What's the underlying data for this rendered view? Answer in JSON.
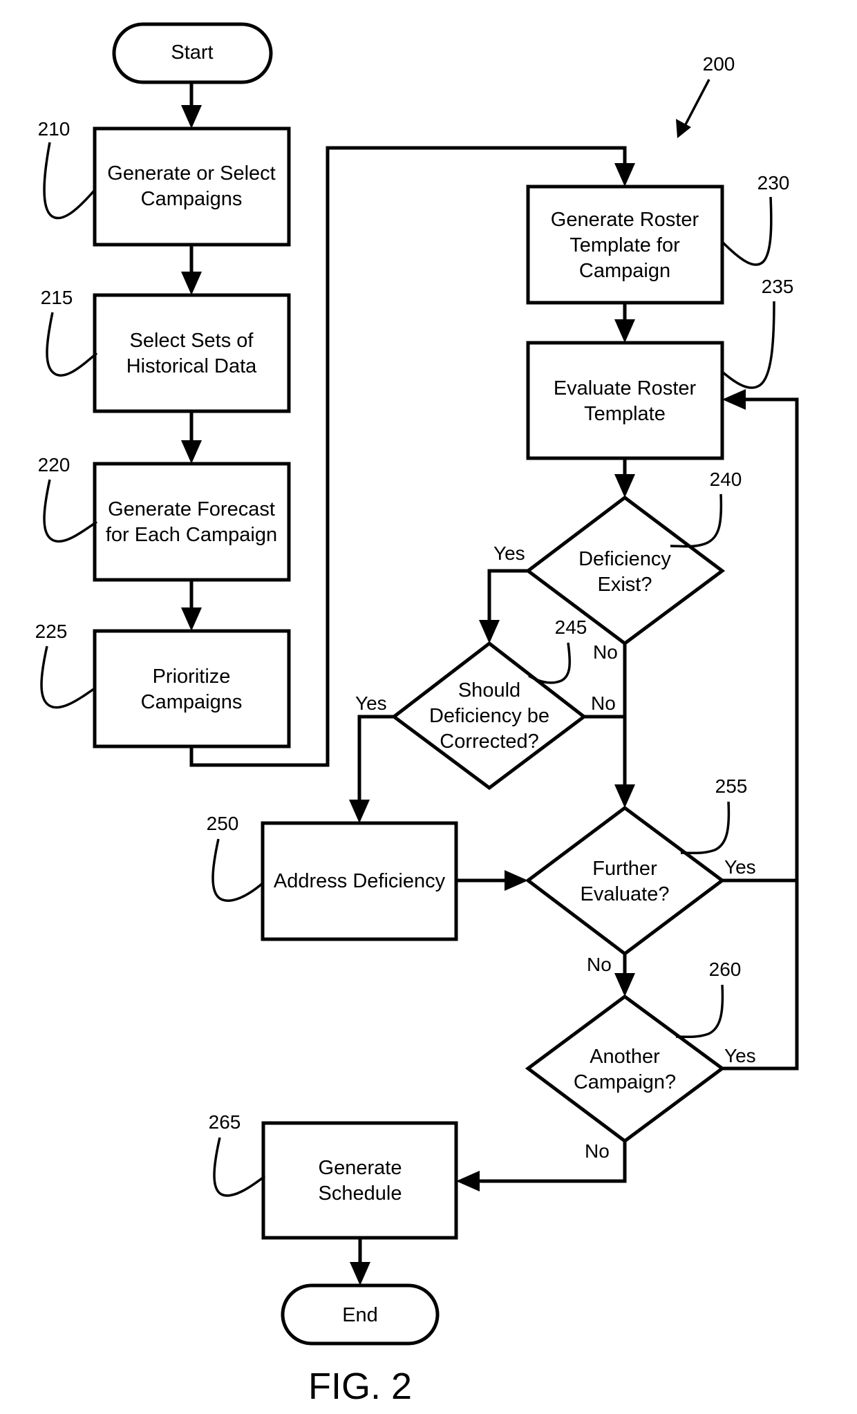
{
  "figure": {
    "caption": "FIG. 2",
    "reference": "200",
    "type": "flowchart"
  },
  "nodes": {
    "start": {
      "text": [
        "Start"
      ]
    },
    "n210": {
      "ref": "210",
      "text": [
        "Generate or Select",
        "Campaigns"
      ]
    },
    "n215": {
      "ref": "215",
      "text": [
        "Select Sets of",
        "Historical Data"
      ]
    },
    "n220": {
      "ref": "220",
      "text": [
        "Generate Forecast",
        "for Each Campaign"
      ]
    },
    "n225": {
      "ref": "225",
      "text": [
        "Prioritize",
        "Campaigns"
      ]
    },
    "n230": {
      "ref": "230",
      "text": [
        "Generate Roster",
        "Template for",
        "Campaign"
      ]
    },
    "n235": {
      "ref": "235",
      "text": [
        "Evaluate Roster",
        "Template"
      ]
    },
    "n240": {
      "ref": "240",
      "text": [
        "Deficiency",
        "Exist?"
      ]
    },
    "n245": {
      "ref": "245",
      "text": [
        "Should",
        "Deficiency be",
        "Corrected?"
      ]
    },
    "n250": {
      "ref": "250",
      "text": [
        "Address Deficiency"
      ]
    },
    "n255": {
      "ref": "255",
      "text": [
        "Further",
        "Evaluate?"
      ]
    },
    "n260": {
      "ref": "260",
      "text": [
        "Another",
        "Campaign?"
      ]
    },
    "n265": {
      "ref": "265",
      "text": [
        "Generate",
        "Schedule"
      ]
    },
    "end": {
      "text": [
        "End"
      ]
    }
  },
  "edge_labels": {
    "e240_yes": "Yes",
    "e240_no": "No",
    "e245_yes": "Yes",
    "e245_no": "No",
    "e255_yes": "Yes",
    "e255_no": "No",
    "e260_yes": "Yes",
    "e260_no": "No"
  },
  "edges": [
    {
      "from": "start",
      "to": "n210"
    },
    {
      "from": "n210",
      "to": "n215"
    },
    {
      "from": "n215",
      "to": "n220"
    },
    {
      "from": "n220",
      "to": "n225"
    },
    {
      "from": "n225",
      "to": "n230"
    },
    {
      "from": "n230",
      "to": "n235"
    },
    {
      "from": "n235",
      "to": "n240"
    },
    {
      "from": "n240",
      "to": "n245",
      "label": "Yes"
    },
    {
      "from": "n240",
      "to": "n255",
      "label": "No"
    },
    {
      "from": "n245",
      "to": "n250",
      "label": "Yes"
    },
    {
      "from": "n245",
      "to": "n255",
      "label": "No"
    },
    {
      "from": "n250",
      "to": "n255"
    },
    {
      "from": "n255",
      "to": "n235",
      "label": "Yes"
    },
    {
      "from": "n255",
      "to": "n260",
      "label": "No"
    },
    {
      "from": "n260",
      "to": "n235",
      "label": "Yes"
    },
    {
      "from": "n260",
      "to": "n265",
      "label": "No"
    },
    {
      "from": "n265",
      "to": "end"
    }
  ]
}
